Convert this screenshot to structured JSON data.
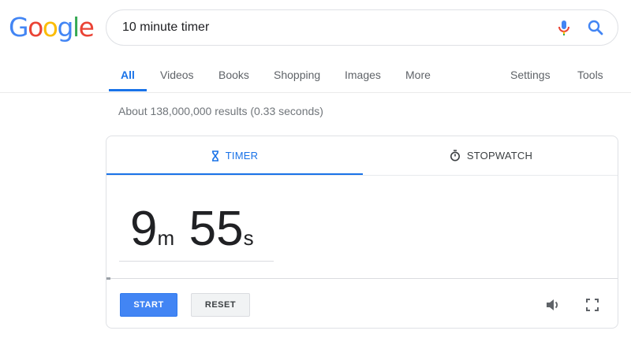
{
  "logo": {
    "letters": [
      "G",
      "o",
      "o",
      "g",
      "l",
      "e"
    ]
  },
  "search": {
    "query": "10 minute timer",
    "mic_icon": "mic-icon",
    "search_icon": "search-icon"
  },
  "tabs": [
    {
      "label": "All",
      "active": true
    },
    {
      "label": "Videos"
    },
    {
      "label": "Books"
    },
    {
      "label": "Shopping"
    },
    {
      "label": "Images"
    },
    {
      "label": "More"
    }
  ],
  "tools": {
    "settings": "Settings",
    "tools": "Tools"
  },
  "result_stats": "About 138,000,000 results (0.33 seconds)",
  "timer_card": {
    "tabs": [
      {
        "label": "TIMER",
        "icon": "hourglass-icon",
        "active": true
      },
      {
        "label": "STOPWATCH",
        "icon": "stopwatch-icon"
      }
    ],
    "minutes": "9",
    "minutes_unit": "m",
    "seconds": "55",
    "seconds_unit": "s",
    "progress": 0.008,
    "buttons": {
      "start": "START",
      "reset": "RESET"
    },
    "icons": [
      "volume-icon",
      "fullscreen-icon"
    ]
  },
  "colors": {
    "accent": "#1a73e8",
    "start_button": "#4285f4"
  }
}
